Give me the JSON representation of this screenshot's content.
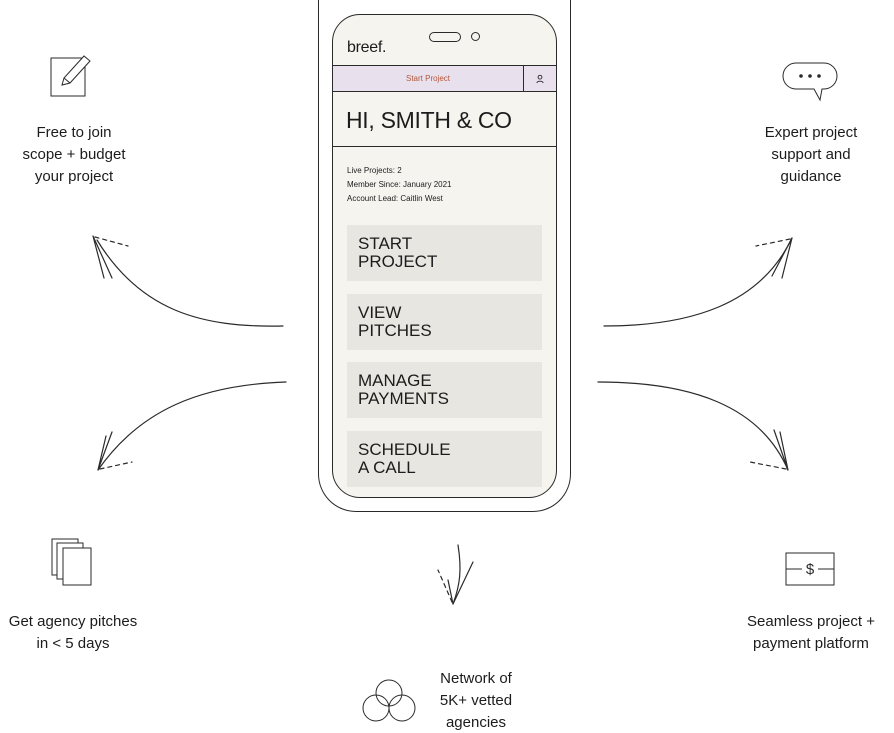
{
  "app": {
    "logo": "breef.",
    "start_bar_label": "Start Project",
    "greeting": "HI, SMITH & CO",
    "info": {
      "live_projects": "Live Projects: 2",
      "member_since": "Member Since: January 2021",
      "account_lead": "Account Lead: Caitlin West"
    },
    "menu": [
      {
        "label": "START\nPROJECT"
      },
      {
        "label": "VIEW\nPITCHES"
      },
      {
        "label": "MANAGE\nPAYMENTS"
      },
      {
        "label": "SCHEDULE\nA CALL"
      }
    ]
  },
  "features": {
    "free_to_join": {
      "text": "Free to join\nscope + budget\nyour project",
      "icon": "pencil-square-icon"
    },
    "expert_support": {
      "text": "Expert project\nsupport and\nguidance",
      "icon": "chat-bubble-icon"
    },
    "agency_pitches": {
      "text": "Get agency pitches\nin < 5 days",
      "icon": "document-stack-icon"
    },
    "payment_platform": {
      "text": "Seamless project +\npayment platform",
      "icon": "dollar-bill-icon",
      "symbol": "$"
    },
    "network": {
      "text": "Network of\n5K+ vetted\nagencies",
      "icon": "overlapping-circles-icon"
    }
  }
}
